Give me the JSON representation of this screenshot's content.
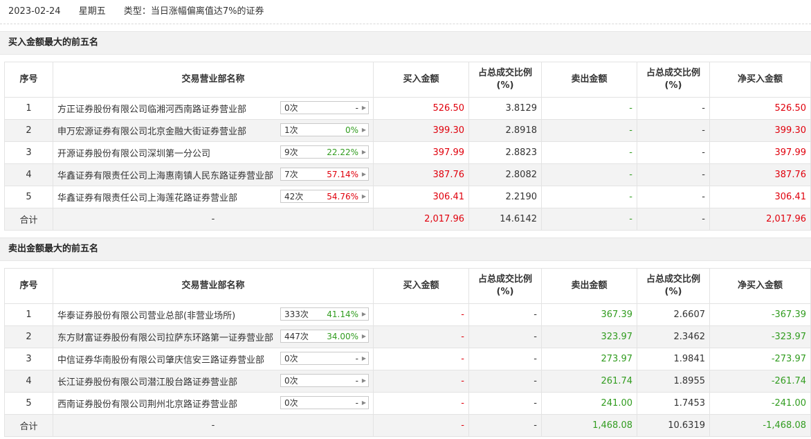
{
  "header": {
    "date": "2023-02-24",
    "weekday": "星期五",
    "type_text": "类型：当日涨幅偏离值达7%的证券"
  },
  "columns": {
    "idx": "序号",
    "name": "交易营业部名称",
    "buy": "买入金额",
    "buy_pct": "占总成交比例(%)",
    "sell": "卖出金额",
    "sell_pct": "占总成交比例(%)",
    "net": "净买入金额"
  },
  "buy_section": {
    "title": "买入金额最大的前五名",
    "rows": [
      {
        "idx": "1",
        "name": "方正证券股份有限公司临湘河西南路证券营业部",
        "count": "0次",
        "rate": "-",
        "rate_color": "#333333",
        "buy": "526.50",
        "buy_pct": "3.8129",
        "sell": "-",
        "sell_pct": "-",
        "net": "526.50"
      },
      {
        "idx": "2",
        "name": "申万宏源证券有限公司北京金融大街证券营业部",
        "count": "1次",
        "rate": "0%",
        "rate_color": "#319c1f",
        "buy": "399.30",
        "buy_pct": "2.8918",
        "sell": "-",
        "sell_pct": "-",
        "net": "399.30"
      },
      {
        "idx": "3",
        "name": "开源证券股份有限公司深圳第一分公司",
        "count": "9次",
        "rate": "22.22%",
        "rate_color": "#319c1f",
        "buy": "397.99",
        "buy_pct": "2.8823",
        "sell": "-",
        "sell_pct": "-",
        "net": "397.99"
      },
      {
        "idx": "4",
        "name": "华鑫证券有限责任公司上海惠南镇人民东路证券营业部",
        "count": "7次",
        "rate": "57.14%",
        "rate_color": "#e0000c",
        "buy": "387.76",
        "buy_pct": "2.8082",
        "sell": "-",
        "sell_pct": "-",
        "net": "387.76"
      },
      {
        "idx": "5",
        "name": "华鑫证券有限责任公司上海莲花路证券营业部",
        "count": "42次",
        "rate": "54.76%",
        "rate_color": "#e0000c",
        "buy": "306.41",
        "buy_pct": "2.2190",
        "sell": "-",
        "sell_pct": "-",
        "net": "306.41"
      }
    ],
    "total": {
      "label": "合计",
      "name": "-",
      "buy": "2,017.96",
      "buy_pct": "14.6142",
      "sell": "-",
      "sell_pct": "-",
      "net": "2,017.96"
    }
  },
  "sell_section": {
    "title": "卖出金额最大的前五名",
    "rows": [
      {
        "idx": "1",
        "name": "华泰证券股份有限公司营业总部(非营业场所)",
        "count": "333次",
        "rate": "41.14%",
        "rate_color": "#319c1f",
        "buy": "-",
        "buy_pct": "-",
        "sell": "367.39",
        "sell_pct": "2.6607",
        "net": "-367.39"
      },
      {
        "idx": "2",
        "name": "东方财富证券股份有限公司拉萨东环路第一证券营业部",
        "count": "447次",
        "rate": "34.00%",
        "rate_color": "#319c1f",
        "buy": "-",
        "buy_pct": "-",
        "sell": "323.97",
        "sell_pct": "2.3462",
        "net": "-323.97"
      },
      {
        "idx": "3",
        "name": "中信证券华南股份有限公司肇庆信安三路证券营业部",
        "count": "0次",
        "rate": "-",
        "rate_color": "#333333",
        "buy": "-",
        "buy_pct": "-",
        "sell": "273.97",
        "sell_pct": "1.9841",
        "net": "-273.97"
      },
      {
        "idx": "4",
        "name": "长江证券股份有限公司潜江股台路证券营业部",
        "count": "0次",
        "rate": "-",
        "rate_color": "#333333",
        "buy": "-",
        "buy_pct": "-",
        "sell": "261.74",
        "sell_pct": "1.8955",
        "net": "-261.74"
      },
      {
        "idx": "5",
        "name": "西南证券股份有限公司荆州北京路证券营业部",
        "count": "0次",
        "rate": "-",
        "rate_color": "#333333",
        "buy": "-",
        "buy_pct": "-",
        "sell": "241.00",
        "sell_pct": "1.7453",
        "net": "-241.00"
      }
    ],
    "total": {
      "label": "合计",
      "name": "-",
      "buy": "-",
      "buy_pct": "-",
      "sell": "1,468.08",
      "sell_pct": "10.6319",
      "net": "-1,468.08"
    }
  },
  "colors": {
    "buy": "#e0000c",
    "sell": "#319c1f"
  }
}
